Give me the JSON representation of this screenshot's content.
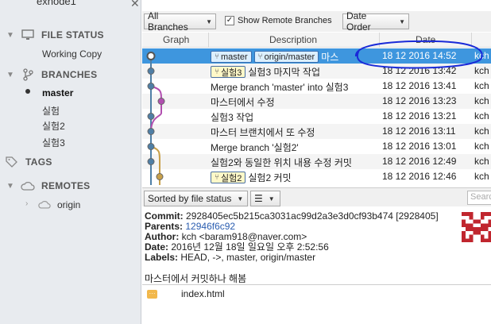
{
  "repo": {
    "title": "exnode1"
  },
  "sidebar": {
    "file_status": {
      "label": "FILE STATUS",
      "items": [
        "Working Copy"
      ]
    },
    "branches": {
      "label": "BRANCHES",
      "items": [
        "master",
        "실험",
        "실험2",
        "실험3"
      ],
      "active": "master"
    },
    "tags": {
      "label": "TAGS"
    },
    "remotes": {
      "label": "REMOTES",
      "items": [
        "origin"
      ]
    }
  },
  "toolbar": {
    "branch_filter": "All Branches",
    "show_remote_label": "Show Remote Branches",
    "show_remote_checked": true,
    "order": "Date Order"
  },
  "columns": {
    "graph": "Graph",
    "description": "Description",
    "date": "Date"
  },
  "commits": [
    {
      "tags": [
        {
          "label": "master",
          "style": "blue"
        },
        {
          "label": "origin/master",
          "style": "blue"
        }
      ],
      "message": "마스",
      "date": "18 12 2016 14:52",
      "author": "kch",
      "selected": true
    },
    {
      "tags": [
        {
          "label": "실험3",
          "style": "yellow"
        }
      ],
      "message": "실험3 마지막 작업",
      "date": "18 12 2016 13:42",
      "author": "kch"
    },
    {
      "tags": [],
      "message": "Merge branch 'master' into 실험3",
      "date": "18 12 2016 13:41",
      "author": "kch"
    },
    {
      "tags": [],
      "message": "마스터에서 수정",
      "date": "18 12 2016 13:23",
      "author": "kch"
    },
    {
      "tags": [],
      "message": "실험3 작업",
      "date": "18 12 2016 13:21",
      "author": "kch"
    },
    {
      "tags": [],
      "message": "마스터 브랜치에서 또 수정",
      "date": "18 12 2016 13:11",
      "author": "kch"
    },
    {
      "tags": [],
      "message": "Merge branch '실험2'",
      "date": "18 12 2016 13:01",
      "author": "kch"
    },
    {
      "tags": [],
      "message": "실험2와 동일한 위치 내용 수정 커밋",
      "date": "18 12 2016 12:49",
      "author": "kch"
    },
    {
      "tags": [
        {
          "label": "실험2",
          "style": "yellow"
        }
      ],
      "message": "실험2 커밋",
      "date": "18 12 2016 12:46",
      "author": "kch"
    }
  ],
  "bottom_bar": {
    "sort": "Sorted by file status",
    "search_placeholder": "Searc"
  },
  "details": {
    "commit_label": "Commit:",
    "commit_value": "2928405ec5b215ca3031ac99d2a3e3d0cf93b474 [2928405]",
    "parents_label": "Parents:",
    "parents_value": "12946f6c92",
    "author_label": "Author:",
    "author_value": "kch <baram918@naver.com>",
    "date_label": "Date:",
    "date_value": "2016년 12월 18일 일요일 오후 2:52:56",
    "labels_label": "Labels:",
    "labels_value": "HEAD, ->, master, origin/master",
    "message": "마스터에서 커밋하나 해봄"
  },
  "files": [
    {
      "name": "index.html",
      "icon": "modified-file-icon"
    }
  ],
  "colors": {
    "selection": "#3e96de",
    "branch_main": "#4f7fa6",
    "branch_purple": "#b24fb0",
    "branch_gold": "#c8a04a",
    "annotation": "#1a2ad8"
  }
}
